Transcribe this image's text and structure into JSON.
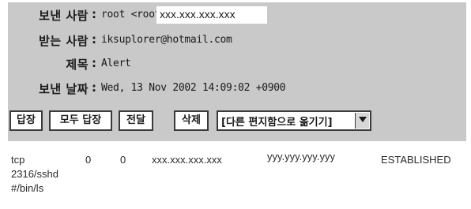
{
  "header": {
    "from": {
      "label": "보낸 사람",
      "value_prefix": "root <root@",
      "value_highlight": "xxx.xxx.xxx.xxx"
    },
    "to": {
      "label": "받는 사람",
      "value": "iksuplorer@hotmail.com"
    },
    "subject": {
      "label": "제목",
      "value": "Alert"
    },
    "date": {
      "label": "보낸 날짜",
      "value": "Wed, 13 Nov 2002 14:09:02 +0900"
    },
    "separator": ":"
  },
  "toolbar": {
    "reply_label": "답장",
    "reply_all_label": "모두 답장",
    "forward_label": "전달",
    "delete_label": "삭제",
    "move_select_value": "[다른 편지함으로 옮기기]"
  },
  "message_body": {
    "connection": {
      "proto": "tcp",
      "recv_q": "0",
      "send_q": "0",
      "local_address": "xxx.xxx.xxx.xxx",
      "foreign_address": "yyy.yyy.yyy.yyy",
      "state": "ESTABLISHED"
    },
    "process": "2316/sshd",
    "path": "#/bin/ls"
  },
  "colors": {
    "header_background": "#c9c9c9",
    "button_border": "#3a3a3a",
    "page_background": "#ffffff"
  },
  "icons": {
    "dropdown": "chevron-down-icon"
  }
}
